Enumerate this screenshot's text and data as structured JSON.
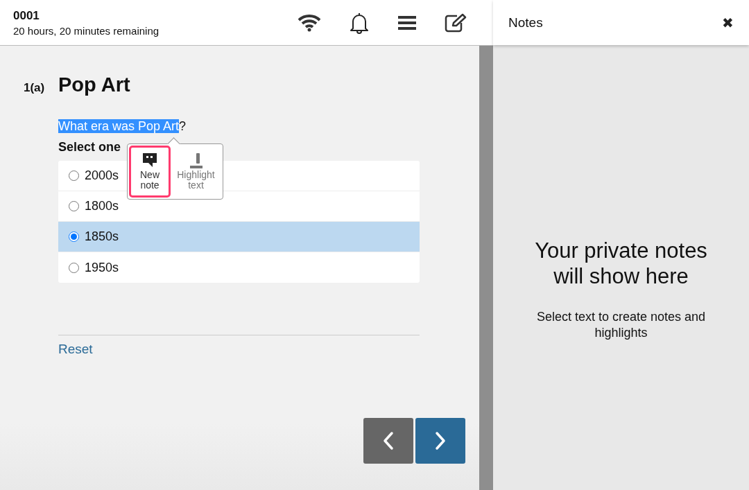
{
  "header": {
    "title": "0001",
    "subtitle": "20 hours, 20 minutes remaining"
  },
  "question": {
    "number": "1(a)",
    "title": "Pop Art",
    "prompt_selected": "What era was Pop Art",
    "prompt_rest": "?",
    "instruction": "Select one",
    "options": [
      {
        "label": "2000s",
        "selected": false
      },
      {
        "label": "1800s",
        "selected": false
      },
      {
        "label": "1850s",
        "selected": true
      },
      {
        "label": "1950s",
        "selected": false
      }
    ],
    "reset": "Reset"
  },
  "popup": {
    "actions": [
      {
        "kind": "note",
        "label": "New note",
        "focused": true
      },
      {
        "kind": "highlight",
        "label": "Highlight text",
        "focused": false
      }
    ]
  },
  "notes_panel": {
    "title": "Notes",
    "close": "✖",
    "empty_title": "Your private notes will show here",
    "empty_text": "Select text to create notes and highlights"
  }
}
